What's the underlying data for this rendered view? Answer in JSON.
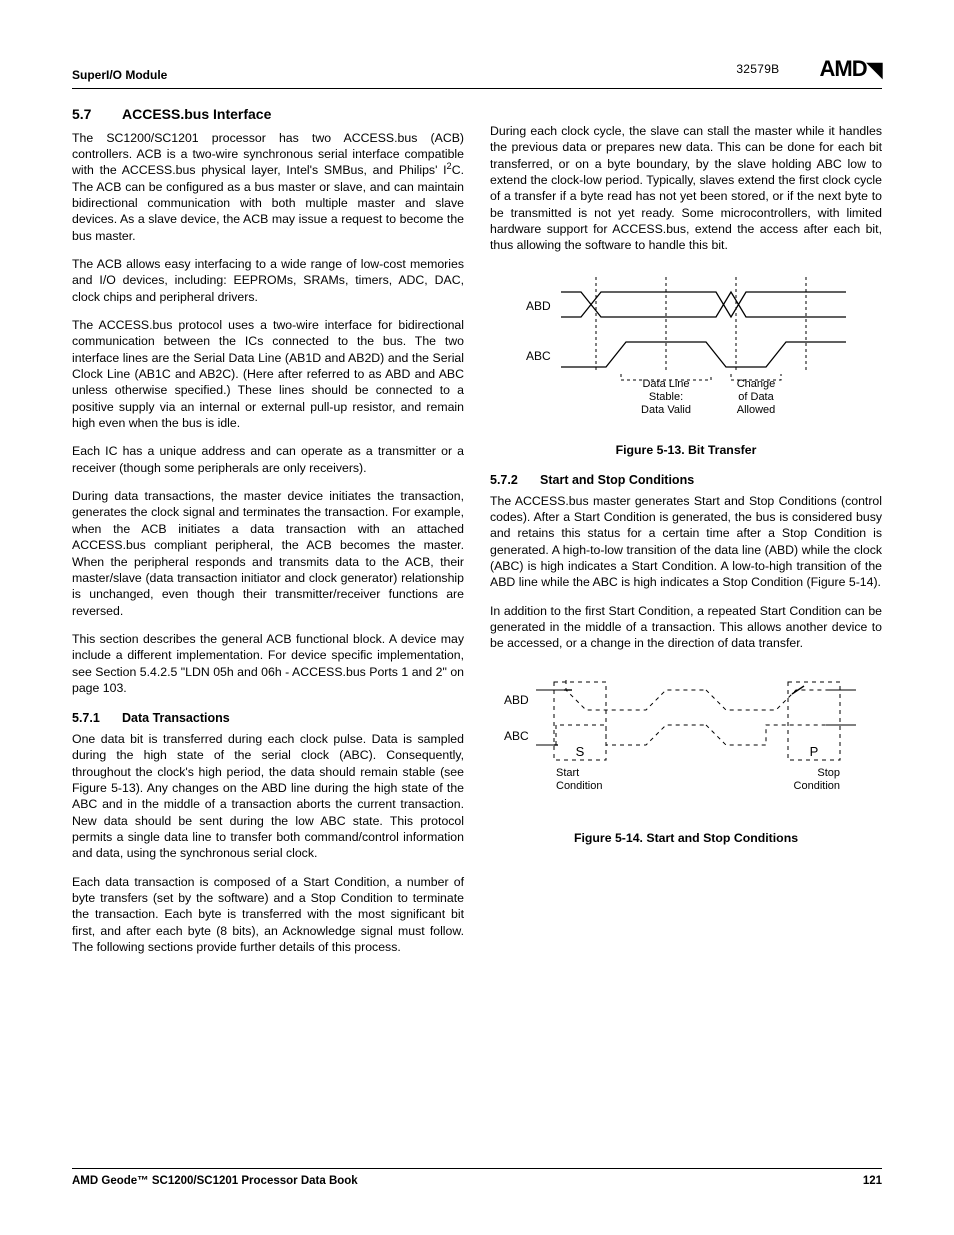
{
  "header": {
    "module": "SuperI/O Module",
    "docid": "32579B",
    "logo": "AMD"
  },
  "section": {
    "number": "5.7",
    "title": "ACCESS.bus Interface"
  },
  "left": {
    "p1": "The SC1200/SC1201 processor has two ACCESS.bus (ACB) controllers. ACB is a two-wire synchronous serial interface compatible with the ACCESS.bus physical layer, Intel's SMBus, and Philips' I",
    "p1b": "C. The ACB can be configured as a bus master or slave, and can maintain bidirectional communication with both multiple master and slave devices. As a slave device, the ACB may issue a request to become the bus master.",
    "p2": "The ACB allows easy interfacing to a wide range of low-cost memories and I/O devices, including: EEPROMs, SRAMs, timers, ADC, DAC, clock chips and peripheral drivers.",
    "p3": "The ACCESS.bus protocol uses a two-wire interface for bidirectional communication between the ICs connected to the bus. The two interface lines are the Serial Data Line (AB1D and AB2D) and the Serial Clock Line (AB1C and AB2C). (Here after referred to as ABD and ABC unless otherwise specified.) These lines should be connected to a positive supply via an internal or external pull-up resistor, and remain high even when the bus is idle.",
    "p4": "Each IC has a unique address and can operate as a transmitter or a receiver (though some peripherals are only receivers).",
    "p5": "During data transactions, the master device initiates the transaction, generates the clock signal and terminates the transaction. For example, when the ACB initiates a data transaction with an attached ACCESS.bus compliant peripheral, the ACB becomes the master. When the peripheral responds and transmits data to the ACB, their master/slave (data transaction initiator and clock generator) relationship is unchanged, even though their transmitter/receiver functions are reversed.",
    "p6": "This section describes the general ACB functional block. A device may include a different implementation. For device specific implementation, see Section 5.4.2.5 \"LDN 05h and 06h - ACCESS.bus Ports 1 and 2\" on page 103.",
    "sub571_num": "5.7.1",
    "sub571_title": "Data Transactions",
    "p7": "One data bit is transferred during each clock pulse. Data is sampled during the high state of the serial clock (ABC). Consequently, throughout the clock's high period, the data should remain stable (see Figure 5-13). Any changes on the ABD line during the high state of the ABC and in the middle of a transaction aborts the current transaction. New data should be sent during the low ABC state. This protocol permits a single data line to transfer both command/control information and data, using the synchronous serial clock.",
    "p8": "Each data transaction is composed of a Start Condition, a number of byte transfers (set by the software) and a Stop Condition to terminate the transaction. Each byte is transferred with the most significant bit first, and after each byte (8 bits), an Acknowledge signal must follow. The following sections provide further details of this process."
  },
  "right": {
    "p1": "During each clock cycle, the slave can stall the master while it handles the previous data or prepares new data. This can be done for each bit transferred, or on a byte boundary, by the slave holding ABC low to extend the clock-low period. Typically, slaves extend the first clock cycle of a transfer if a byte read has not yet been stored, or if the next byte to be transmitted is not yet ready. Some microcontrollers, with limited hardware support for ACCESS.bus, extend the access after each bit, thus allowing the software to handle this bit.",
    "fig13": {
      "abd": "ABD",
      "abc": "ABC",
      "lbl1a": "Data Line",
      "lbl1b": "Stable:",
      "lbl1c": "Data Valid",
      "lbl2a": "Change",
      "lbl2b": "of Data",
      "lbl2c": "Allowed",
      "caption": "Figure 5-13.  Bit Transfer"
    },
    "sub572_num": "5.7.2",
    "sub572_title": "Start and Stop Conditions",
    "p2": "The ACCESS.bus master generates Start and Stop Conditions (control codes). After a Start Condition is generated, the bus is considered busy and retains this status for a certain time after a Stop Condition is generated. A high-to-low transition of the data line (ABD) while the clock (ABC) is high indicates a Start Condition. A low-to-high transition of the ABD line while the ABC is high indicates a Stop Condition (Figure 5-14).",
    "p3": "In addition to the first Start Condition, a repeated Start Condition can be generated in the middle of a transaction. This allows another device to be accessed, or a change in the direction of data transfer.",
    "fig14": {
      "abd": "ABD",
      "abc": "ABC",
      "s": "S",
      "p": "P",
      "start1": "Start",
      "start2": "Condition",
      "stop1": "Stop",
      "stop2": "Condition",
      "caption": "Figure 5-14.  Start and Stop Conditions"
    }
  },
  "footer": {
    "book": "AMD Geode™ SC1200/SC1201 Processor Data Book",
    "page": "121"
  }
}
